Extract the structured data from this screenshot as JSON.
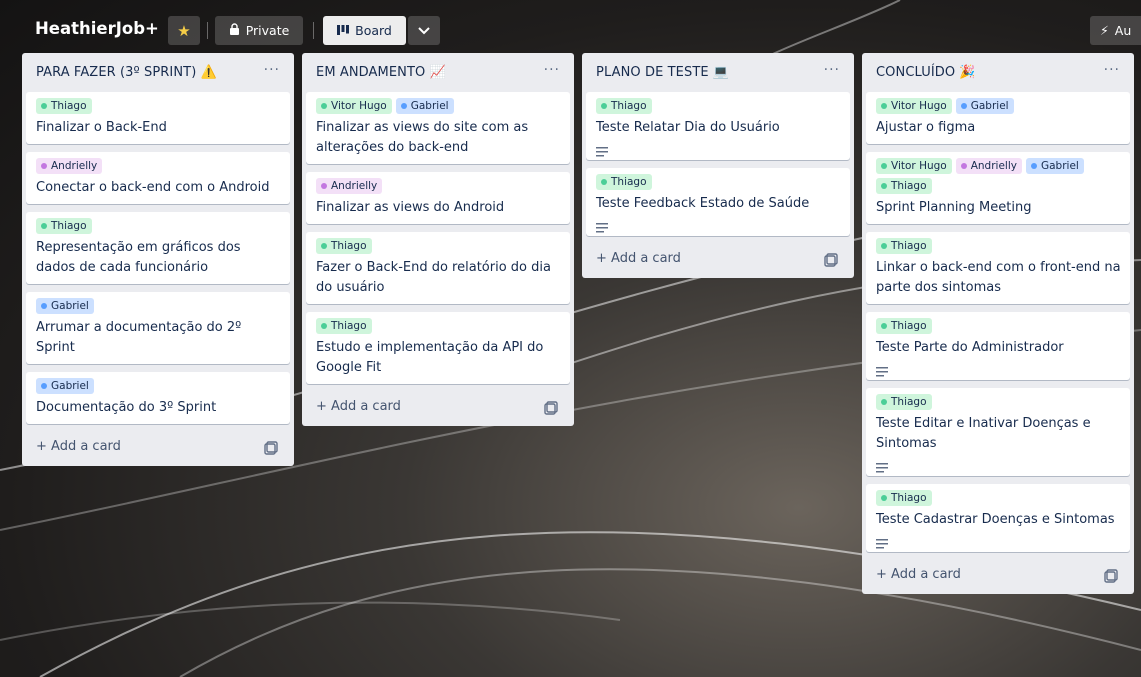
{
  "header": {
    "title": "HeathierJob+",
    "visibility": "Private",
    "view": "Board",
    "automation": "Au"
  },
  "lists": [
    {
      "title": "PARA FAZER (3º SPRINT) ⚠️",
      "add_label": "+ Add a card",
      "cards": [
        {
          "labels": [
            {
              "text": "Thiago",
              "color": "green"
            }
          ],
          "title": "Finalizar o Back-End",
          "desc": false
        },
        {
          "labels": [
            {
              "text": "Andrielly",
              "color": "purple"
            }
          ],
          "title": "Conectar o back-end com o Android",
          "desc": false
        },
        {
          "labels": [
            {
              "text": "Thiago",
              "color": "green"
            }
          ],
          "title": "Representação em gráficos dos dados de cada funcionário",
          "desc": false
        },
        {
          "labels": [
            {
              "text": "Gabriel",
              "color": "blue"
            }
          ],
          "title": "Arrumar a documentação do 2º Sprint",
          "desc": false
        },
        {
          "labels": [
            {
              "text": "Gabriel",
              "color": "blue"
            }
          ],
          "title": "Documentação do 3º Sprint",
          "desc": false
        }
      ]
    },
    {
      "title": "EM ANDAMENTO 📈",
      "add_label": "+ Add a card",
      "cards": [
        {
          "labels": [
            {
              "text": "Vitor Hugo",
              "color": "green"
            },
            {
              "text": "Gabriel",
              "color": "blue"
            }
          ],
          "title": "Finalizar as views do site com as alterações do back-end",
          "desc": false
        },
        {
          "labels": [
            {
              "text": "Andrielly",
              "color": "purple"
            }
          ],
          "title": "Finalizar as views do Android",
          "desc": false
        },
        {
          "labels": [
            {
              "text": "Thiago",
              "color": "green"
            }
          ],
          "title": "Fazer o Back-End do relatório do dia do usuário",
          "desc": false
        },
        {
          "labels": [
            {
              "text": "Thiago",
              "color": "green"
            }
          ],
          "title": "Estudo e implementação da API do Google Fit",
          "desc": false
        }
      ]
    },
    {
      "title": "PLANO DE TESTE 💻",
      "add_label": "+ Add a card",
      "cards": [
        {
          "labels": [
            {
              "text": "Thiago",
              "color": "green"
            }
          ],
          "title": "Teste Relatar Dia do Usuário",
          "desc": true
        },
        {
          "labels": [
            {
              "text": "Thiago",
              "color": "green"
            }
          ],
          "title": "Teste Feedback Estado de Saúde",
          "desc": true
        }
      ]
    },
    {
      "title": "CONCLUÍDO 🎉",
      "add_label": "+ Add a card",
      "cards": [
        {
          "labels": [
            {
              "text": "Vitor Hugo",
              "color": "green"
            },
            {
              "text": "Gabriel",
              "color": "blue"
            }
          ],
          "title": "Ajustar o figma",
          "desc": false
        },
        {
          "labels": [
            {
              "text": "Vitor Hugo",
              "color": "green"
            },
            {
              "text": "Andrielly",
              "color": "purple"
            },
            {
              "text": "Gabriel",
              "color": "blue"
            },
            {
              "text": "Thiago",
              "color": "green"
            }
          ],
          "title": "Sprint Planning Meeting",
          "desc": false
        },
        {
          "labels": [
            {
              "text": "Thiago",
              "color": "green"
            }
          ],
          "title": "Linkar o back-end com o front-end na parte dos sintomas",
          "desc": false
        },
        {
          "labels": [
            {
              "text": "Thiago",
              "color": "green"
            }
          ],
          "title": "Teste Parte do Administrador",
          "desc": true
        },
        {
          "labels": [
            {
              "text": "Thiago",
              "color": "green"
            }
          ],
          "title": "Teste Editar e Inativar Doenças e Sintomas",
          "desc": true
        },
        {
          "labels": [
            {
              "text": "Thiago",
              "color": "green"
            }
          ],
          "title": "Teste Cadastrar Doenças e Sintomas",
          "desc": true
        }
      ]
    }
  ]
}
